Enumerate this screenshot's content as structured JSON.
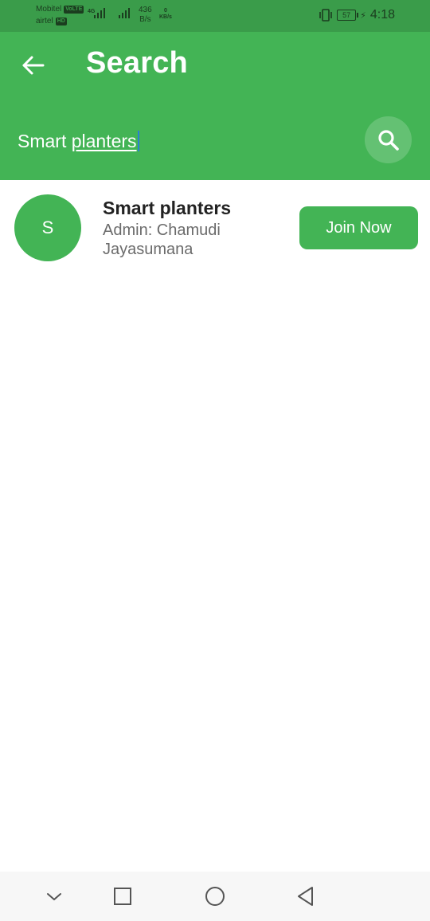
{
  "status_bar": {
    "carrier1": "Mobitel",
    "carrier1_badge": "VoLTE",
    "carrier2": "airtel",
    "carrier2_badge": "HD",
    "network_type": "4G",
    "speed_value": "436",
    "speed_unit": "B/s",
    "kb_value": "0",
    "kb_unit": "KB/s",
    "battery": "57",
    "time": "4:18"
  },
  "header": {
    "title": "Search",
    "back_icon": "arrow-left-icon",
    "search_icon": "magnifier-icon"
  },
  "search": {
    "query_part1": "Smart ",
    "query_part2": "planters"
  },
  "results": [
    {
      "avatar_letter": "S",
      "name": "Smart planters",
      "admin": "Admin: Chamudi Jayasumana",
      "action_label": "Join Now"
    }
  ],
  "colors": {
    "primary": "#43b455",
    "status_bar": "#3a9c4a",
    "caret": "#2a7fd4"
  },
  "nav_bar": {
    "icons": [
      "chevron-down-icon",
      "square-icon",
      "circle-icon",
      "triangle-back-icon"
    ]
  }
}
